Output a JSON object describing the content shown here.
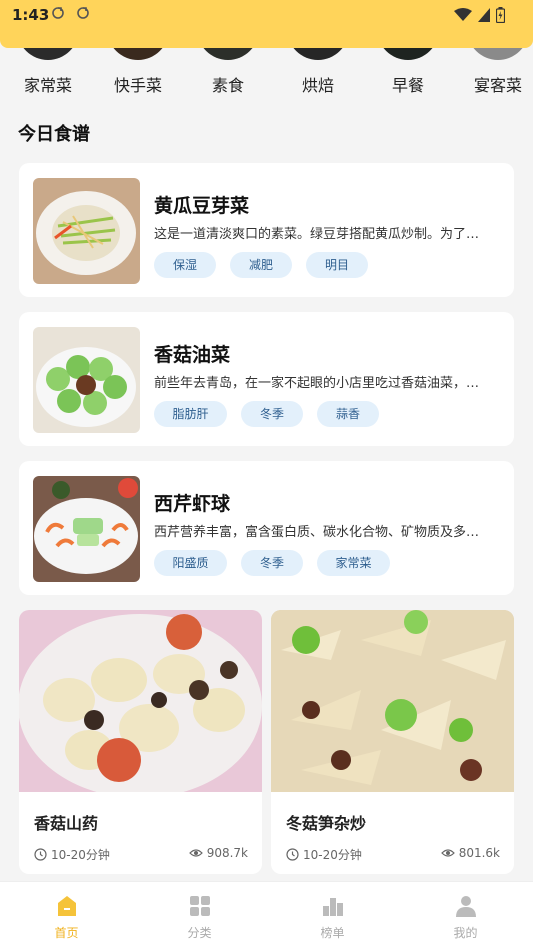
{
  "status_bar": {
    "time": "1:43"
  },
  "categories": [
    {
      "label": "家常菜"
    },
    {
      "label": "快手菜"
    },
    {
      "label": "素食"
    },
    {
      "label": "烘焙"
    },
    {
      "label": "早餐"
    },
    {
      "label": "宴客菜"
    }
  ],
  "section": {
    "title": "今日食谱"
  },
  "recipes": [
    {
      "title": "黄瓜豆芽菜",
      "desc": "这是一道清淡爽口的素菜。绿豆芽搭配黄瓜炒制。为了…",
      "tags": [
        "保湿",
        "减肥",
        "明目"
      ]
    },
    {
      "title": "香菇油菜",
      "desc": "前些年去青岛，在一家不起眼的小店里吃过香菇油菜，…",
      "tags": [
        "脂肪肝",
        "冬季",
        "蒜香"
      ]
    },
    {
      "title": "西芹虾球",
      "desc": "西芹营养丰富，富含蛋白质、碳水化合物、矿物质及多…",
      "tags": [
        "阳盛质",
        "冬季",
        "家常菜"
      ]
    }
  ],
  "grid": [
    {
      "title": "香菇山药",
      "time": "10-20分钟",
      "views": "908.7k"
    },
    {
      "title": "冬菇笋杂炒",
      "time": "10-20分钟",
      "views": "801.6k"
    }
  ],
  "nav": [
    {
      "label": "首页"
    },
    {
      "label": "分类"
    },
    {
      "label": "榜单"
    },
    {
      "label": "我的"
    }
  ],
  "colors": {
    "accent": "#ffd45a",
    "active_nav": "#f0b21e",
    "tag_bg": "#e3f0fb"
  }
}
